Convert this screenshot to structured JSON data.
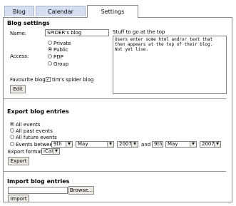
{
  "tabs": [
    {
      "label": "Blog"
    },
    {
      "label": "Calendar"
    },
    {
      "label": "Settings"
    }
  ],
  "blog_settings": {
    "heading": "Blog settings",
    "name_label": "Name:",
    "name_value": "SPIDER's blog",
    "access_label": "Access:",
    "access_options": [
      "Private",
      "Public",
      "PDP",
      "Group"
    ],
    "access_selected": "Public",
    "stuff_label": "Stuff to go at the top",
    "stuff_text": "Users enter some html and/or text that\nthen appears at the top of their blog.\nNot yet live.",
    "favourite_label": "Favourite blogs",
    "favourite_item": "tim's spider blog",
    "favourite_checked": true,
    "edit_button": "Edit"
  },
  "export": {
    "heading": "Export blog entries",
    "options": [
      "All events",
      "All past events",
      "All future events",
      "Events between"
    ],
    "selected": "All events",
    "from_day": "9th",
    "from_month": "May",
    "from_year": "2007",
    "and_label": "and",
    "to_day": "9th",
    "to_month": "May",
    "to_year": "2007",
    "format_label": "Export format",
    "format_value": "iCal",
    "export_button": "Export"
  },
  "import": {
    "heading": "Import blog entries",
    "browse_button": "Browse...",
    "import_button": "Import"
  }
}
